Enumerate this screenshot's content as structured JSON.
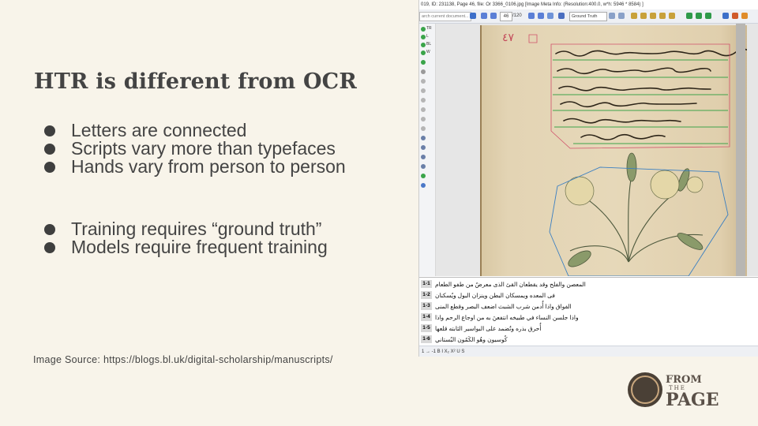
{
  "slide": {
    "title": "HTR is different from OCR",
    "bullets_group1": [
      "Letters are connected",
      "Scripts vary more than typefaces",
      "Hands vary from person to person"
    ],
    "bullets_group2": [
      "Training requires “ground truth”",
      "Models require frequent training"
    ],
    "source": "Image Source: https://blogs.bl.uk/digital-scholarship/manuscripts/"
  },
  "screenshot": {
    "window_title": "019, ID: 231138, Page 46, file: Or 3366_0106.jpg [Image Meta Info: (Resolution:400.0, w*h: 5946 * 8584) ]",
    "search_placeholder": "arch current document...",
    "page_number": "46",
    "page_total": "/120",
    "version_select": "Ground Truth",
    "left_labels": [
      "TR",
      "L",
      "BL",
      "W"
    ],
    "lines": [
      {
        "num": "1-1",
        "text": "المعصن والفلح وقد يقطعان القئ الذى معرضُ من طفو الطعام"
      },
      {
        "num": "1-2",
        "text": "فى المعده ويمسكان البطن وينزان البول ويُسكنان"
      },
      {
        "num": "1-3",
        "text": "الفواق واذا أُدمن شرب الشبث اضعف البصر وقطع المنى"
      },
      {
        "num": "1-4",
        "text": "واذا جلسن النساء في طبيخه انتفعنَ به من اوجاع الرحم واذا"
      },
      {
        "num": "1-5",
        "text": "أُحرق بذره وتُضمد على البواسير الثابته قلعها"
      },
      {
        "num": "1-6",
        "text": "كُوسيون وهُو الكَمُون البُستاني"
      }
    ],
    "bottom_toolbar": "1 → -1  B  I  X₂  X²  U  S"
  },
  "logo": {
    "line1": "FROM",
    "line2": "THE",
    "line3": "PAGE"
  },
  "colors": {
    "background": "#f8f4ea",
    "text": "#444444",
    "logo": "#4a4036",
    "ink_red": "#b8352a",
    "ink_green": "#2e8a34"
  }
}
